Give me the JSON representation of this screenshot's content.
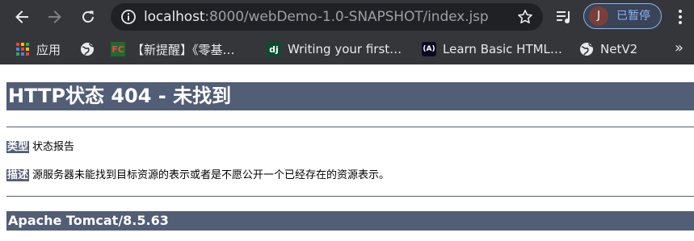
{
  "browser": {
    "address_host": "localhost",
    "address_rest": ":8000/webDemo-1.0-SNAPSHOT/index.jsp",
    "profile_initial": "J",
    "profile_status": "已暂停",
    "bookmarks": [
      {
        "label": "应用",
        "icon": "apps-grid-icon"
      },
      {
        "label": "",
        "icon": "globe-icon"
      },
      {
        "label": "【新提醒】《零基…",
        "icon": "fc-favicon-icon",
        "icon_text": "FC"
      },
      {
        "label": "Writing your first…",
        "icon": "django-favicon-icon",
        "icon_text": "dj"
      },
      {
        "label": "Learn Basic HTML…",
        "icon": "freecodecamp-favicon-icon",
        "icon_text": "(A)"
      },
      {
        "label": "NetV2",
        "icon": "globe-icon"
      }
    ],
    "more_bookmarks": "»"
  },
  "page": {
    "title": "HTTP状态 404 - 未找到",
    "type_label": "类型",
    "type_value": "状态报告",
    "desc_label": "描述",
    "desc_value": "源服务器未能找到目标资源的表示或者是不愿公开一个已经存在的资源表示。",
    "server": "Apache Tomcat/8.5.63"
  },
  "colors": {
    "chrome_bg": "#35363a",
    "omnibox_bg": "#202124",
    "tomcat_bar": "#525d76",
    "profile_accent": "#8ab4f8"
  }
}
